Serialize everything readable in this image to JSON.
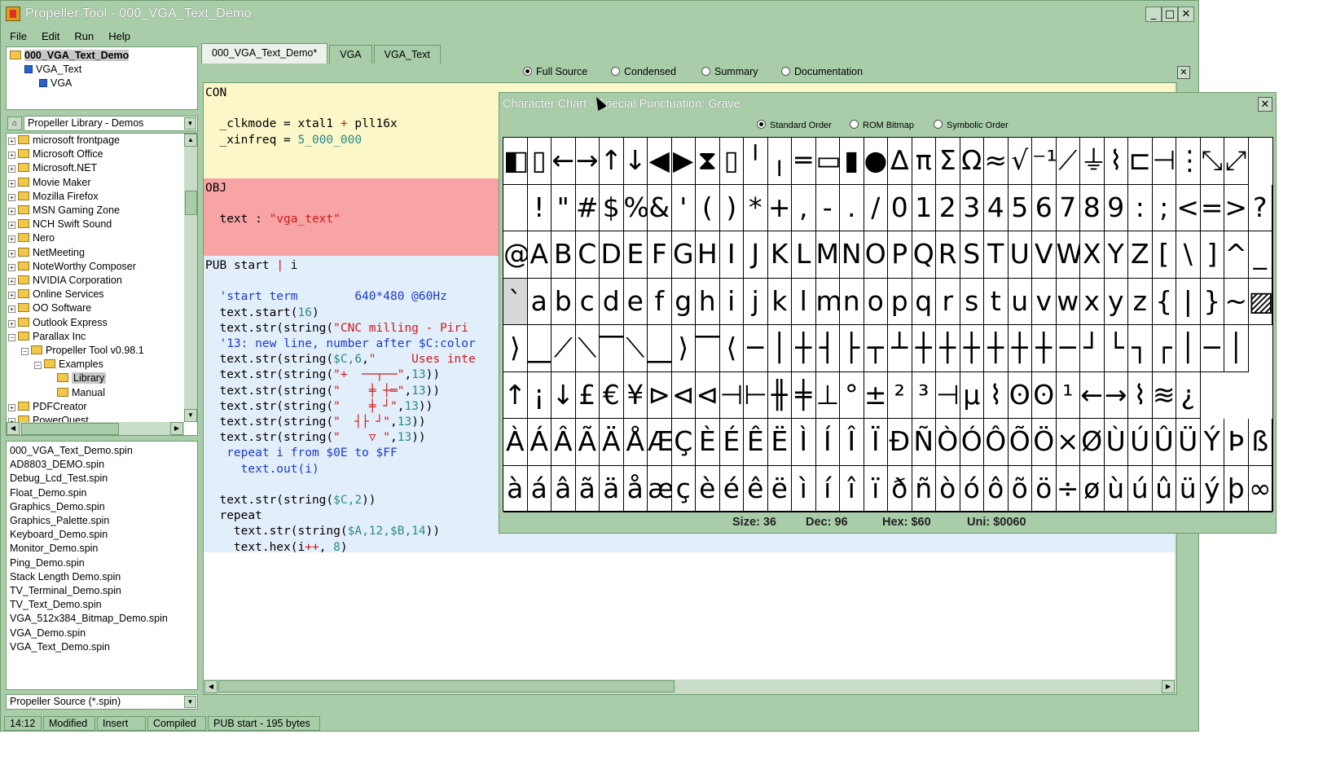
{
  "window": {
    "title": "Propeller Tool - 000_VGA_Text_Demo",
    "min": "_",
    "max": "□",
    "close": "✕"
  },
  "menu": [
    "File",
    "Edit",
    "Run",
    "Help"
  ],
  "object_tree": [
    {
      "label": "000_VGA_Text_Demo",
      "level": 0,
      "bold": true
    },
    {
      "label": "VGA_Text",
      "level": 1
    },
    {
      "label": "VGA",
      "level": 2
    }
  ],
  "library": {
    "selected": "Propeller Library - Demos"
  },
  "folders": [
    {
      "label": "microsoft frontpage",
      "level": 0
    },
    {
      "label": "Microsoft Office",
      "level": 0
    },
    {
      "label": "Microsoft.NET",
      "level": 0
    },
    {
      "label": "Movie Maker",
      "level": 0
    },
    {
      "label": "Mozilla Firefox",
      "level": 0
    },
    {
      "label": "MSN Gaming Zone",
      "level": 0
    },
    {
      "label": "NCH Swift Sound",
      "level": 0
    },
    {
      "label": "Nero",
      "level": 0
    },
    {
      "label": "NetMeeting",
      "level": 0
    },
    {
      "label": "NoteWorthy Composer",
      "level": 0
    },
    {
      "label": "NVIDIA Corporation",
      "level": 0
    },
    {
      "label": "Online Services",
      "level": 0
    },
    {
      "label": "OO Software",
      "level": 0
    },
    {
      "label": "Outlook Express",
      "level": 0
    },
    {
      "label": "Parallax Inc",
      "level": 0
    },
    {
      "label": "Propeller Tool v0.98.1",
      "level": 1
    },
    {
      "label": "Examples",
      "level": 2
    },
    {
      "label": "Library",
      "level": 3,
      "selected": true
    },
    {
      "label": "Manual",
      "level": 3
    },
    {
      "label": "PDFCreator",
      "level": 0
    },
    {
      "label": "PowerQuest",
      "level": 0
    }
  ],
  "files": [
    "000_VGA_Text_Demo.spin",
    "AD8803_DEMO.spin",
    "Debug_Lcd_Test.spin",
    "Float_Demo.spin",
    "Graphics_Demo.spin",
    "Graphics_Palette.spin",
    "Keyboard_Demo.spin",
    "Monitor_Demo.spin",
    "Ping_Demo.spin",
    "Stack Length Demo.spin",
    "TV_Terminal_Demo.spin",
    "TV_Text_Demo.spin",
    "VGA_512x384_Bitmap_Demo.spin",
    "VGA_Demo.spin",
    "VGA_Text_Demo.spin"
  ],
  "file_filter": "Propeller Source (*.spin)",
  "tabs": [
    "000_VGA_Text_Demo*",
    "VGA",
    "VGA_Text"
  ],
  "view_modes": [
    "Full Source",
    "Condensed",
    "Summary",
    "Documentation"
  ],
  "view_selected": 0,
  "code": {
    "con": [
      [
        [
          "kw",
          "CON"
        ]
      ],
      [],
      [
        [
          "kw",
          "  _clkmode = xtal1 "
        ],
        [
          "op",
          "+"
        ],
        [
          "kw",
          " pll16x"
        ]
      ],
      [
        [
          "kw",
          "  _xinfreq = "
        ],
        [
          "num",
          "5_000_000"
        ]
      ]
    ],
    "obj": [
      [
        [
          "kw",
          "OBJ"
        ]
      ],
      [],
      [
        [
          "kw",
          "  text : "
        ],
        [
          "str",
          "\"vga_text\""
        ]
      ]
    ],
    "pub": [
      [
        [
          "kw",
          "PUB start "
        ],
        [
          "op",
          "|"
        ],
        [
          "kw",
          " i"
        ]
      ],
      [],
      [
        [
          "cmt",
          "  'start term        640*480 @60Hz"
        ]
      ],
      [
        [
          "kw",
          "  text.start("
        ],
        [
          "num",
          "16"
        ],
        [
          "kw",
          ")"
        ]
      ],
      [
        [
          "kw",
          "  text.str(string("
        ],
        [
          "str",
          "\"CNC milling - Piri"
        ]
      ],
      [
        [
          "cmt",
          "  '13: new line, number after $C:color"
        ]
      ],
      [
        [
          "kw",
          "  text.str(string("
        ],
        [
          "num",
          "$C,6"
        ],
        [
          "kw",
          ","
        ],
        [
          "str",
          "\"     Uses inte"
        ]
      ],
      [
        [
          "kw",
          "  text.str(string("
        ],
        [
          "str",
          "\"+  ──┬──\""
        ],
        [
          "kw",
          ","
        ],
        [
          "num",
          "13"
        ],
        [
          "kw",
          "))"
        ]
      ],
      [
        [
          "kw",
          "  text.str(string("
        ],
        [
          "str",
          "\"    ╪ ┼═\""
        ],
        [
          "kw",
          ","
        ],
        [
          "num",
          "13"
        ],
        [
          "kw",
          "))"
        ]
      ],
      [
        [
          "kw",
          "  text.str(string("
        ],
        [
          "str",
          "\"    ╪ ┘\""
        ],
        [
          "kw",
          ","
        ],
        [
          "num",
          "13"
        ],
        [
          "kw",
          "))"
        ]
      ],
      [
        [
          "kw",
          "  text.str(string("
        ],
        [
          "str",
          "\"  ┤├ ┘\""
        ],
        [
          "kw",
          ","
        ],
        [
          "num",
          "13"
        ],
        [
          "kw",
          "))"
        ]
      ],
      [
        [
          "kw",
          "  text.str(string("
        ],
        [
          "str",
          "\"    ▽ \""
        ],
        [
          "kw",
          ","
        ],
        [
          "num",
          "13"
        ],
        [
          "kw",
          "))"
        ]
      ],
      [
        [
          "cmt",
          "   repeat i from $0E to $FF"
        ]
      ],
      [
        [
          "cmt",
          "     text.out(i)"
        ]
      ],
      [],
      [
        [
          "kw",
          "  text.str(string("
        ],
        [
          "num",
          "$C,2"
        ],
        [
          "kw",
          "))"
        ]
      ],
      [
        [
          "kw",
          "  repeat"
        ]
      ],
      [
        [
          "kw",
          "    text.str(string("
        ],
        [
          "num",
          "$A,12,$B,14"
        ],
        [
          "kw",
          "))"
        ]
      ],
      [
        [
          "kw",
          "    text.hex(i"
        ],
        [
          "op",
          "++"
        ],
        [
          "kw",
          ", "
        ],
        [
          "num",
          "8"
        ],
        [
          "kw",
          ")"
        ]
      ]
    ]
  },
  "status": [
    "14:12",
    "Modified",
    "Insert",
    "Compiled",
    "PUB start - 195 bytes"
  ],
  "char_chart": {
    "title": "Character Chart - Special Punctuation: Grave",
    "close": "✕",
    "orders": [
      "Standard Order",
      "ROM Bitmap",
      "Symbolic Order"
    ],
    "order_selected": 0,
    "rows": [
      [
        "◧",
        "▯",
        "←",
        "→",
        "↑",
        "↓",
        "◀",
        "▶",
        "⧗",
        "▯",
        "╵",
        "╷",
        "═",
        "▭",
        "▮",
        "●",
        "∆",
        "π",
        "Σ",
        "Ω",
        "≈",
        "√",
        "⁻¹",
        "⟋",
        "⏚",
        "⌇",
        "⊏",
        "⊣",
        "⋮",
        "⤡",
        "⤢"
      ],
      [
        " ",
        "!",
        "\"",
        "#",
        "$",
        "%",
        "&",
        "'",
        "(",
        ")",
        "*",
        "+",
        ",",
        "-",
        ".",
        "/",
        "0",
        "1",
        "2",
        "3",
        "4",
        "5",
        "6",
        "7",
        "8",
        "9",
        ":",
        ";",
        "<",
        "=",
        ">",
        "?"
      ],
      [
        "@",
        "A",
        "B",
        "C",
        "D",
        "E",
        "F",
        "G",
        "H",
        "I",
        "J",
        "K",
        "L",
        "M",
        "N",
        "O",
        "P",
        "Q",
        "R",
        "S",
        "T",
        "U",
        "V",
        "W",
        "X",
        "Y",
        "Z",
        "[",
        "\\",
        "]",
        "^",
        "_"
      ],
      [
        "`",
        "a",
        "b",
        "c",
        "d",
        "e",
        "f",
        "g",
        "h",
        "i",
        "j",
        "k",
        "l",
        "m",
        "n",
        "o",
        "p",
        "q",
        "r",
        "s",
        "t",
        "u",
        "v",
        "w",
        "x",
        "y",
        "z",
        "{",
        "|",
        "}",
        "~",
        "▨"
      ],
      [
        "⟩",
        "⎽",
        "⟋",
        "⟍",
        "⎺",
        "⟍",
        "⎽",
        "⟩",
        "⎺",
        "⟨",
        "─",
        "│",
        "┼",
        "┤",
        "├",
        "┬",
        "┴",
        "┼",
        "┼",
        "┼",
        "┼",
        "┼",
        "┼",
        "─",
        "┘",
        "└",
        "┐",
        "┌",
        "│",
        "─",
        "│"
      ],
      [
        "↑",
        "¡",
        "↓",
        "£",
        "€",
        "¥",
        "⊳",
        "⊲",
        "⊲",
        "⊣",
        "⊢",
        "╫",
        "╪",
        "⊥",
        "°",
        "±",
        "²",
        "³",
        "⊣",
        "µ",
        "⌇",
        "ʘ",
        "ʘ",
        "¹",
        "←",
        "→",
        "⌇",
        "≋",
        "¿"
      ],
      [
        "À",
        "Á",
        "Â",
        "Ã",
        "Ä",
        "Å",
        "Æ",
        "Ç",
        "È",
        "É",
        "Ê",
        "Ë",
        "Ì",
        "Í",
        "Î",
        "Ï",
        "Ð",
        "Ñ",
        "Ò",
        "Ó",
        "Ô",
        "Õ",
        "Ö",
        "×",
        "Ø",
        "Ù",
        "Ú",
        "Û",
        "Ü",
        "Ý",
        "Þ",
        "ß"
      ],
      [
        "à",
        "á",
        "â",
        "ã",
        "ä",
        "å",
        "æ",
        "ç",
        "è",
        "é",
        "ê",
        "ë",
        "ì",
        "í",
        "î",
        "ï",
        "ð",
        "ñ",
        "ò",
        "ó",
        "ô",
        "õ",
        "ö",
        "÷",
        "ø",
        "ù",
        "ú",
        "û",
        "ü",
        "ý",
        "þ",
        "∞"
      ]
    ],
    "selected_row": 3,
    "selected_col": 0,
    "info": {
      "size": "Size: 36",
      "dec": "Dec: 96",
      "hex": "Hex: $60",
      "uni": "Uni: $0060"
    }
  }
}
